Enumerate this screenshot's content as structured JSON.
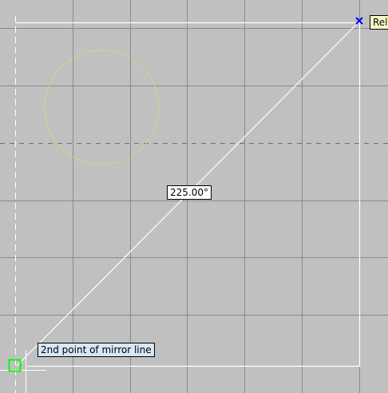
{
  "viewport": {
    "background_color": "#c0c0c0",
    "grid_color": "#8a8a8a",
    "geometry_color": "#ffffff",
    "circle_color": "#e6e64a",
    "snap_marker_color": "#0000ff",
    "pickbox_color": "#00ff00"
  },
  "dimension": {
    "angle_label": "225.00°"
  },
  "prompt": {
    "text": "2nd point of mirror line"
  },
  "snap": {
    "tooltip_text": "Rel"
  }
}
